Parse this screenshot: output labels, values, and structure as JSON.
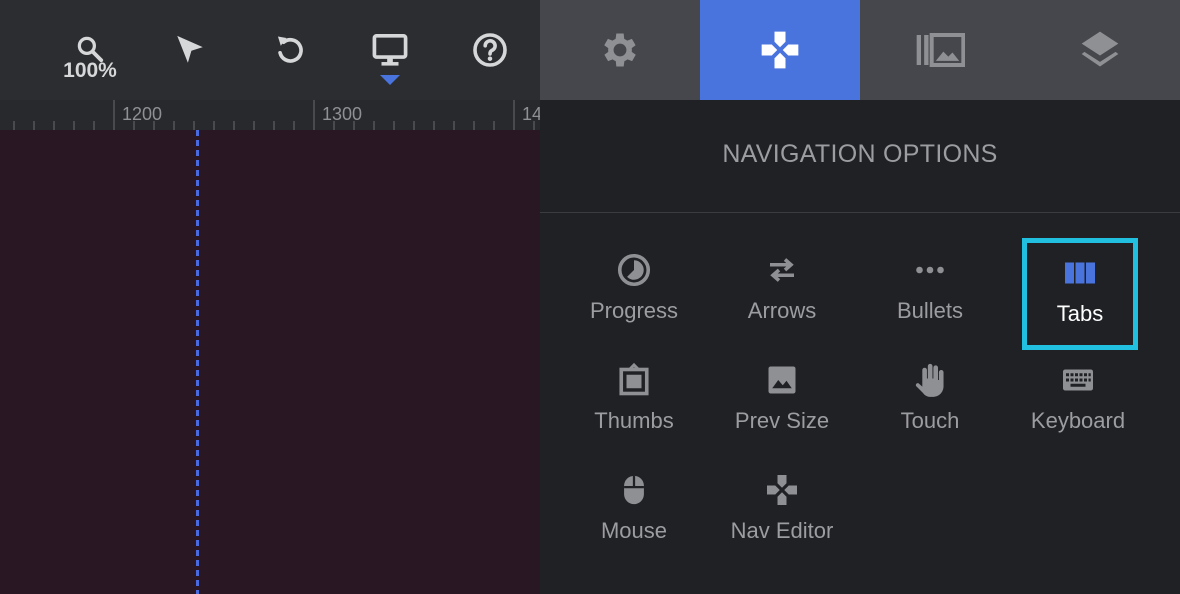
{
  "toolbar": {
    "zoom_value": "100%",
    "tools": [
      {
        "name": "zoom",
        "icon": "magnifier-icon"
      },
      {
        "name": "select",
        "icon": "cursor-arrow-icon"
      },
      {
        "name": "undo",
        "icon": "undo-icon"
      },
      {
        "name": "device",
        "icon": "monitor-icon",
        "active": true
      },
      {
        "name": "help",
        "icon": "help-circle-icon"
      }
    ]
  },
  "ruler": {
    "labels": [
      "1200",
      "1300",
      "14"
    ]
  },
  "panel_tabs": [
    {
      "icon": "gear-icon",
      "active": false
    },
    {
      "icon": "gamepad-icon",
      "active": true
    },
    {
      "icon": "media-library-icon",
      "active": false
    },
    {
      "icon": "layers-icon",
      "active": false
    }
  ],
  "panel": {
    "title": "NAVIGATION OPTIONS",
    "options": [
      {
        "label": "Progress",
        "icon": "progress-icon",
        "selected": false
      },
      {
        "label": "Arrows",
        "icon": "arrows-icon",
        "selected": false
      },
      {
        "label": "Bullets",
        "icon": "bullets-icon",
        "selected": false
      },
      {
        "label": "Tabs",
        "icon": "tabs-icon",
        "selected": true
      },
      {
        "label": "Thumbs",
        "icon": "thumbs-icon",
        "selected": false
      },
      {
        "label": "Prev Size",
        "icon": "image-icon",
        "selected": false
      },
      {
        "label": "Touch",
        "icon": "hand-icon",
        "selected": false
      },
      {
        "label": "Keyboard",
        "icon": "keyboard-icon",
        "selected": false
      },
      {
        "label": "Mouse",
        "icon": "mouse-icon",
        "selected": false
      },
      {
        "label": "Nav Editor",
        "icon": "gamepad-icon",
        "selected": false
      }
    ]
  },
  "colors": {
    "accent_blue": "#4a74dd",
    "selection_cyan": "#22c0e0",
    "canvas_bg": "#2a1724"
  }
}
